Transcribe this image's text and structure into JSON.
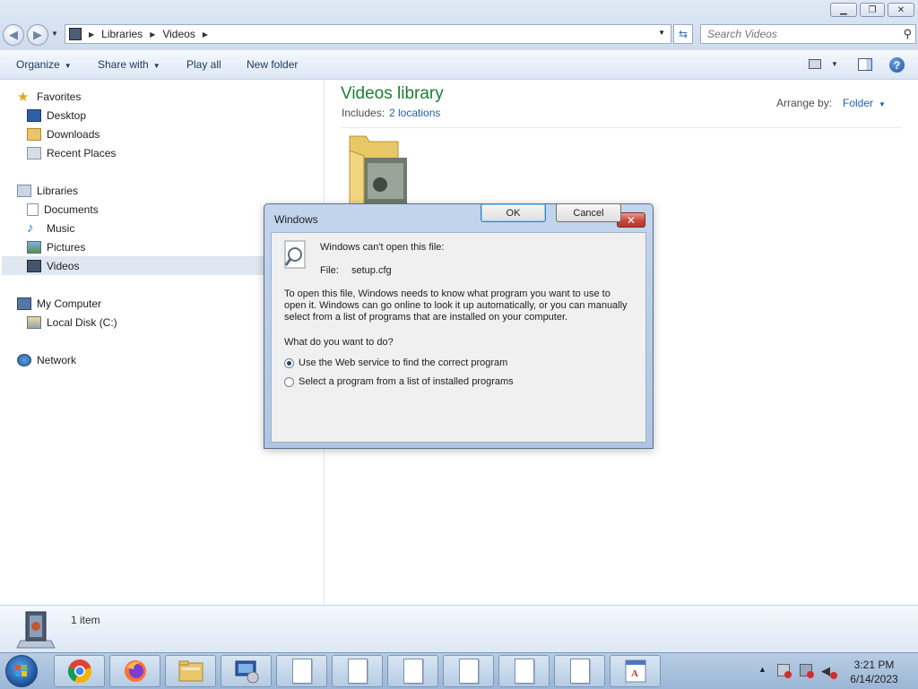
{
  "address": {
    "crumbs": [
      "Libraries",
      "Videos"
    ]
  },
  "search": {
    "placeholder": "Search Videos"
  },
  "toolbar": {
    "organize": "Organize",
    "share_with": "Share with",
    "play_all": "Play all",
    "new_folder": "New folder"
  },
  "nav": {
    "favorites": "Favorites",
    "desktop": "Desktop",
    "downloads": "Downloads",
    "recent_places": "Recent Places",
    "libraries": "Libraries",
    "documents": "Documents",
    "music": "Music",
    "pictures": "Pictures",
    "videos": "Videos",
    "my_computer": "My Computer",
    "local_disk": "Local Disk (C:)",
    "network": "Network"
  },
  "content": {
    "library_title": "Videos library",
    "includes_label": "Includes:",
    "includes_link": "2 locations",
    "arrange_label": "Arrange by:",
    "arrange_value": "Folder"
  },
  "details": {
    "item_count": "1 item"
  },
  "dialog": {
    "title": "Windows",
    "heading": "Windows can't open this file:",
    "file_label": "File:",
    "file_name": "setup.cfg",
    "explanation_line1": "To open this file, Windows needs to know what program you want to use to",
    "explanation_line2": "open it. Windows can go online to look it up automatically, or you can manually",
    "explanation_line3": "select from a list of programs that are installed on your computer.",
    "question": "What do you want to do?",
    "option_web": "Use the Web service to find the correct program",
    "option_list": "Select a program from a list of installed programs",
    "selected_option": "web",
    "ok": "OK",
    "cancel": "Cancel"
  },
  "clock": {
    "time": "3:21 PM",
    "date": "6/14/2023"
  },
  "colors": {
    "library_title": "#1e7d2e",
    "link": "#1f61b4",
    "close_red": "#c4483a"
  }
}
